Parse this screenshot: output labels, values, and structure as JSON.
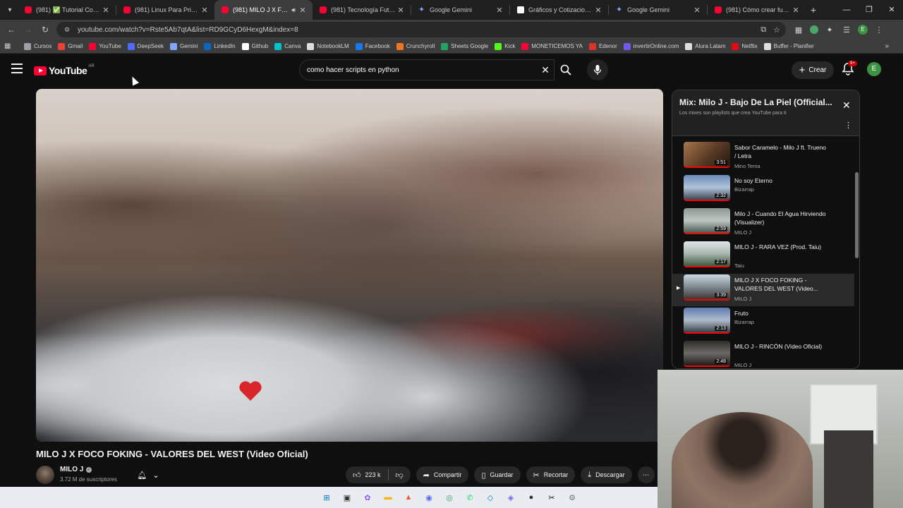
{
  "browser": {
    "tabs": [
      {
        "title": "(981) ✅ Tutorial Comple",
        "favicon": "youtube-icon",
        "active": false
      },
      {
        "title": "(981) Linux Para Principia",
        "favicon": "youtube-icon",
        "active": false
      },
      {
        "title": "(981) MILO J X FOCO",
        "favicon": "youtube-icon",
        "active": true,
        "audio": true
      },
      {
        "title": "(981) Tecnología Futurista",
        "favicon": "youtube-icon",
        "active": false
      },
      {
        "title": "Google Gemini",
        "favicon": "gemini-icon",
        "active": false
      },
      {
        "title": "Gráficos y Cotizaciones -",
        "favicon": "investing-icon",
        "active": false
      },
      {
        "title": "Google Gemini",
        "favicon": "gemini-icon",
        "active": false
      },
      {
        "title": "(981) Cómo crear funcion",
        "favicon": "youtube-icon",
        "active": false
      }
    ],
    "url": "youtube.com/watch?v=Rste5Ab7qtA&list=RD9GCyD6HexgM&index=8",
    "profile_initial": "E",
    "bookmarks": [
      {
        "label": "Cursos",
        "color": "#9aa0a6"
      },
      {
        "label": "Gmail",
        "color": "#ea4335"
      },
      {
        "label": "YouTube",
        "color": "#ff0033"
      },
      {
        "label": "DeepSeek",
        "color": "#4d6bfe"
      },
      {
        "label": "Gemini",
        "color": "#7fa7ff"
      },
      {
        "label": "LinkedIn",
        "color": "#0a66c2"
      },
      {
        "label": "Github",
        "color": "#ffffff"
      },
      {
        "label": "Canva",
        "color": "#00c4cc"
      },
      {
        "label": "NotebookLM",
        "color": "#dddddd"
      },
      {
        "label": "Facebook",
        "color": "#1877f2"
      },
      {
        "label": "Crunchyroll",
        "color": "#f47521"
      },
      {
        "label": "Sheets Google",
        "color": "#1fa463"
      },
      {
        "label": "Kick",
        "color": "#53fc18"
      },
      {
        "label": "MONETICEMOS YA",
        "color": "#ff0033"
      },
      {
        "label": "Edenor",
        "color": "#e0322b"
      },
      {
        "label": "invertirOnline.com",
        "color": "#6c5ce7"
      },
      {
        "label": "Alura Latam",
        "color": "#dddddd"
      },
      {
        "label": "Netflix",
        "color": "#e50914"
      },
      {
        "label": "Buffer - Planifier",
        "color": "#dddddd"
      }
    ]
  },
  "youtube": {
    "logo_text": "YouTube",
    "country": "AR",
    "search_query": "como hacer scripts en python",
    "create_label": "Crear",
    "notif_count": "9+",
    "avatar_initial": "E"
  },
  "video": {
    "title": "MILO J X FOCO FOKING - VALORES DEL WEST (Video Oficial)",
    "channel": "MILO J",
    "subscribers": "3.72 M de suscriptores",
    "likes": "223 k",
    "actions": {
      "share": "Compartir",
      "save": "Guardar",
      "clip": "Recortar",
      "download": "Descargar"
    }
  },
  "playlist": {
    "title": "Mix: Milo J - Bajo De La Piel (Official...",
    "subtitle": "Los mixes son playlists que crea YouTube para ti",
    "items": [
      {
        "title": "Sabor Caramelo - Milo J ft. Trueno / Letra",
        "channel": "Mino Tema",
        "duration": "3:51",
        "thumb": "th1",
        "current": false
      },
      {
        "title": "No soy Eterno",
        "channel": "Bizarrap",
        "duration": "2:32",
        "thumb": "th2",
        "current": false
      },
      {
        "title": "Milo J - Cuando El Agua Hirviendo (Visualizer)",
        "channel": "MILO J",
        "duration": "2:59",
        "thumb": "th3",
        "current": false
      },
      {
        "title": "MILO J - RARA VEZ (Prod. Taiu)",
        "channel": "Taiu",
        "duration": "2:17",
        "thumb": "th4",
        "current": false
      },
      {
        "title": "MILO J X FOCO FOKING - VALORES DEL WEST (Video...",
        "channel": "MILO J",
        "duration": "3:39",
        "thumb": "th5",
        "current": true
      },
      {
        "title": "Fruto",
        "channel": "Bizarrap",
        "duration": "2:13",
        "thumb": "th6",
        "current": false
      },
      {
        "title": "MILO J - RINCÓN (Video Oficial)",
        "channel": "MILO J",
        "duration": "2:48",
        "thumb": "th7",
        "current": false
      }
    ]
  },
  "taskbar": {
    "apps": [
      {
        "name": "windows-start-icon",
        "color": "#0078d4"
      },
      {
        "name": "task-view-icon",
        "color": "#333333"
      },
      {
        "name": "copilot-icon",
        "color": "#8a5cf6"
      },
      {
        "name": "file-explorer-icon",
        "color": "#f4b400"
      },
      {
        "name": "brave-icon",
        "color": "#fb542b"
      },
      {
        "name": "discord-icon",
        "color": "#5865f2"
      },
      {
        "name": "chrome-icon",
        "color": "#34a853"
      },
      {
        "name": "whatsapp-icon",
        "color": "#25d366"
      },
      {
        "name": "vscode-icon",
        "color": "#007acc"
      },
      {
        "name": "app-icon",
        "color": "#7b61ff"
      },
      {
        "name": "obs-icon",
        "color": "#302e31"
      },
      {
        "name": "capcut-icon",
        "color": "#111111"
      },
      {
        "name": "settings-icon",
        "color": "#6b7280"
      }
    ]
  }
}
